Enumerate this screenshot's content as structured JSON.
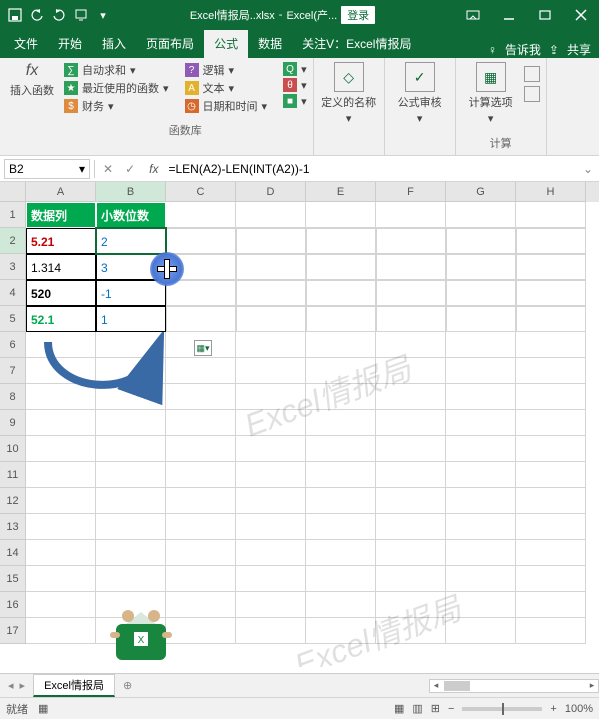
{
  "titlebar": {
    "file_label": "Excel情报局..xlsx",
    "sep": " - ",
    "app_label": "Excel(产...",
    "login": "登录"
  },
  "tabs": {
    "items": [
      "文件",
      "开始",
      "插入",
      "页面布局",
      "公式",
      "数据",
      "关注V：Excel情报局"
    ],
    "active_index": 4,
    "tell_me": "告诉我",
    "share": "共享"
  },
  "ribbon": {
    "insert_fn": "插入函数",
    "lib": {
      "autosum": "自动求和",
      "recent": "最近使用的函数",
      "finance": "财务",
      "logic": "逻辑",
      "text": "文本",
      "datetime": "日期和时间"
    },
    "group_lib": "函数库",
    "defname": "定义的名称",
    "audit": "公式审核",
    "calc_opt": "计算选项",
    "group_calc": "计算"
  },
  "namebox": {
    "ref": "B2"
  },
  "formula": "=LEN(A2)-LEN(INT(A2))-1",
  "columns": [
    "A",
    "B",
    "C",
    "D",
    "E",
    "F",
    "G",
    "H"
  ],
  "row_nums": [
    "1",
    "2",
    "3",
    "4",
    "5",
    "6",
    "7",
    "8",
    "9",
    "10",
    "11",
    "12",
    "13",
    "14",
    "15",
    "16",
    "17"
  ],
  "headers": {
    "a": "数据列",
    "b": "小数位数"
  },
  "dataA": [
    "5.21",
    "1.314",
    "520",
    "52.1"
  ],
  "dataB": [
    "2",
    "3",
    "-1",
    "1"
  ],
  "watermark": "Excel情报局",
  "sheettab": "Excel情报局",
  "status": {
    "ready": "就绪",
    "zoom": "100%"
  },
  "chart_data": {
    "type": "table",
    "columns": [
      "数据列",
      "小数位数"
    ],
    "rows": [
      [
        "5.21",
        "2"
      ],
      [
        "1.314",
        "3"
      ],
      [
        "520",
        "-1"
      ],
      [
        "52.1",
        "1"
      ]
    ],
    "formula_B": "=LEN(A2)-LEN(INT(A2))-1"
  }
}
